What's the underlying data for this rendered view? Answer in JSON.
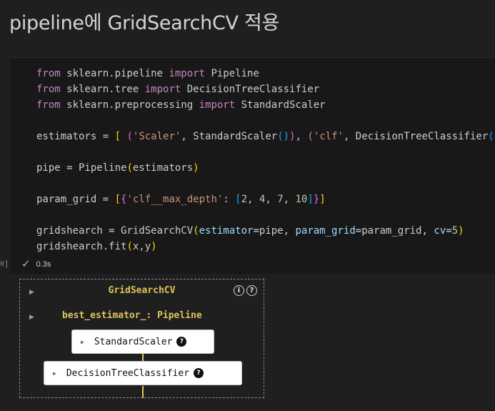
{
  "heading": "pipeline에 GridSearchCV 적용",
  "code": {
    "l1": {
      "a": "from",
      "b": " sklearn.pipeline ",
      "c": "import",
      "d": " Pipeline"
    },
    "l2": {
      "a": "from",
      "b": " sklearn.tree ",
      "c": "import",
      "d": " DecisionTreeClassifier"
    },
    "l3": {
      "a": "from",
      "b": " sklearn.preprocessing ",
      "c": "import",
      "d": " StandardScaler"
    },
    "l5": {
      "t1": "estimators = ",
      "b1": "[",
      "t2": " ",
      "b2": "(",
      "s1": "'Scaler'",
      "t3": ", StandardScaler",
      "b3a": "(",
      "b3b": ")",
      "b2c": ")",
      "t4": ", ",
      "b2o": "(",
      "s2": "'clf'",
      "t5": ", DecisionTreeClassifier",
      "b3c": "(",
      "b3d": ")",
      "b2d": ")",
      "b1c": "]"
    },
    "l7": {
      "t1": "pipe = Pipeline",
      "bo": "(",
      "t2": "estimators",
      "bc": ")"
    },
    "l9": {
      "t1": "param_grid = ",
      "b1": "[",
      "b2": "{",
      "s1": "'clf__max_depth'",
      "t2": ": ",
      "b3": "[",
      "n1": "2",
      "c1": ", ",
      "n2": "4",
      "c2": ", ",
      "n3": "7",
      "c3": ", ",
      "n4": "10",
      "b3c": "]",
      "b2c": "}",
      "b1c": "]"
    },
    "l11": {
      "t1": "gridshearch = GridSearchCV",
      "bo": "(",
      "p1": "estimator",
      "t2": "=pipe, ",
      "p2": "param_grid",
      "t3": "=param_grid, ",
      "p3": "cv",
      "t4": "=",
      "n1": "5",
      "bc": ")"
    },
    "l12": {
      "t1": "gridshearch.fit",
      "bo": "(",
      "t2": "x,y",
      "bc": ")"
    }
  },
  "exec_count": "0]",
  "status": {
    "time": "0.3s"
  },
  "output": {
    "gridsearch_label": "GridSearchCV",
    "info_glyph": "i",
    "help_glyph": "?",
    "best_estimator_label": "best_estimator_: Pipeline",
    "step1": "StandardScaler",
    "step2": "DecisionTreeClassifier"
  },
  "icons": {
    "run_status": "check-icon",
    "expand": "triangle-right-icon",
    "info": "info-icon",
    "help": "help-icon"
  },
  "colors": {
    "keyword": "#c586c0",
    "string": "#ce9178",
    "number": "#b5cea8",
    "estimator_label": "#e0c45a"
  }
}
